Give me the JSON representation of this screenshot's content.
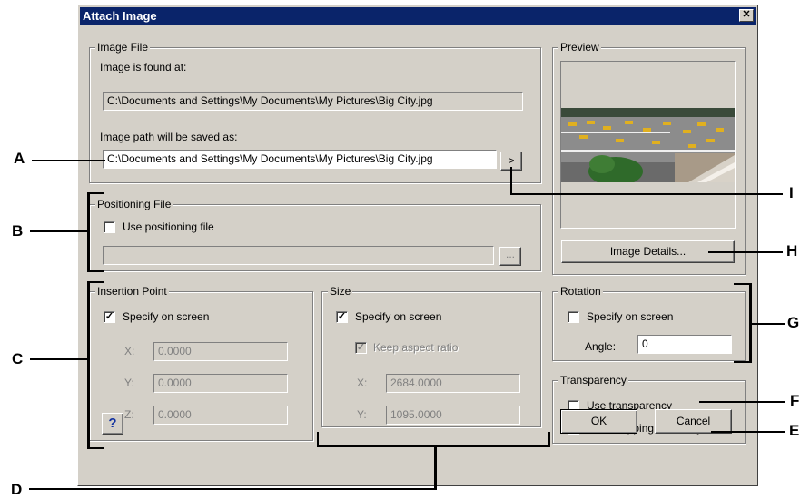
{
  "dialog": {
    "title": "Attach Image",
    "close_glyph": "✕"
  },
  "image_file": {
    "legend": "Image File",
    "found_label": "Image is found at:",
    "found_value": "C:\\Documents and Settings\\My Documents\\My Pictures\\Big City.jpg",
    "saved_label": "Image path will be saved as:",
    "saved_value": "C:\\Documents and Settings\\My Documents\\My Pictures\\Big City.jpg",
    "browse_glyph": ">"
  },
  "positioning_file": {
    "legend": "Positioning File",
    "checkbox_label": "Use positioning file",
    "browse_glyph": "...",
    "path_value": ""
  },
  "insertion_point": {
    "legend": "Insertion Point",
    "specify_label": "Specify on screen",
    "x_label": "X:",
    "x_value": "0.0000",
    "y_label": "Y:",
    "y_value": "0.0000",
    "z_label": "Z:",
    "z_value": "0.0000"
  },
  "size": {
    "legend": "Size",
    "specify_label": "Specify on screen",
    "keep_aspect_label": "Keep aspect ratio",
    "x_label": "X:",
    "x_value": "2684.0000",
    "y_label": "Y:",
    "y_value": "1095.0000"
  },
  "preview": {
    "legend": "Preview",
    "details_button": "Image Details..."
  },
  "rotation": {
    "legend": "Rotation",
    "specify_label": "Specify on screen",
    "angle_label": "Angle:",
    "angle_value": "0"
  },
  "transparency": {
    "legend": "Transparency",
    "use_label": "Use transparency",
    "clip_label": "Show clipping boundary"
  },
  "footer": {
    "help_glyph": "?",
    "ok_label": "OK",
    "cancel_label": "Cancel"
  },
  "callouts": {
    "a": "A",
    "b": "B",
    "c": "C",
    "d": "D",
    "e": "E",
    "f": "F",
    "g": "G",
    "h": "H",
    "i": "I"
  },
  "check_glyph": "✓"
}
